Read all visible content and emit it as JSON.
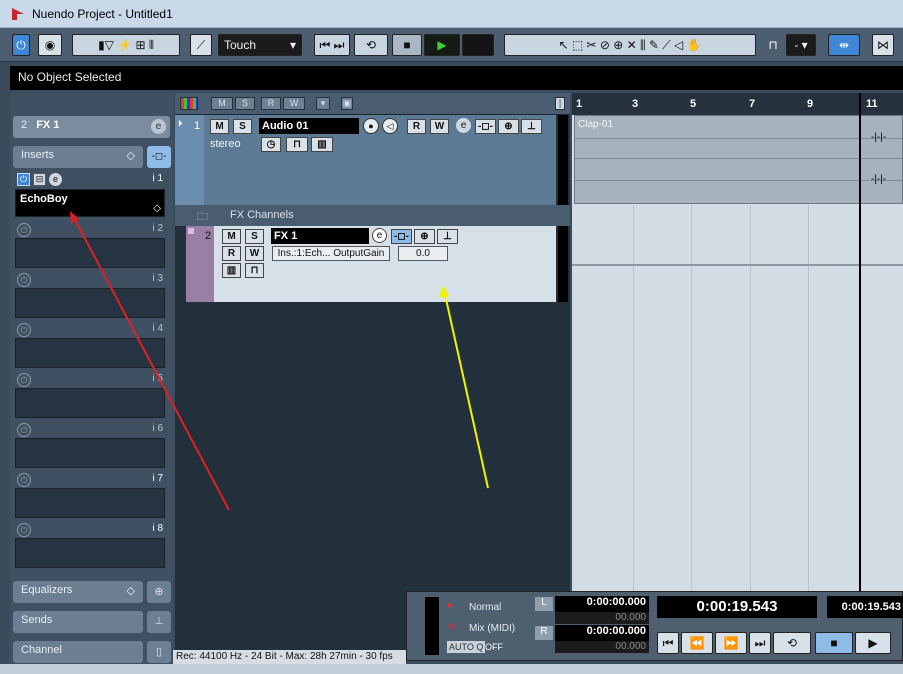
{
  "window": {
    "title": "Nuendo Project - Untitled1"
  },
  "toolbar": {
    "automation_mode": "Touch",
    "quantize_value": "-"
  },
  "status_line": "No Object Selected",
  "inspector": {
    "track_number": "2",
    "track_name": "FX 1",
    "inserts_label": "Inserts",
    "slot1_label": "i 1",
    "slot1_plugin": "EchoBoy",
    "slots": [
      "i 2",
      "i 3",
      "i 4",
      "i 5",
      "i 6",
      "i 7",
      "i 8"
    ],
    "equalizers_label": "Equalizers",
    "sends_label": "Sends",
    "channel_label": "Channel"
  },
  "tracks": {
    "track1": {
      "number": "1",
      "name": "Audio 01",
      "config": "stereo"
    },
    "folder": {
      "name": "FX Channels"
    },
    "track2": {
      "number": "2",
      "name": "FX 1",
      "automation_param": "Ins.:1:Ech... OutputGain",
      "automation_value": "0.0"
    }
  },
  "buttons": {
    "m": "M",
    "s": "S",
    "r": "R",
    "w": "W"
  },
  "ruler": {
    "ticks": [
      "1",
      "3",
      "5",
      "7",
      "9",
      "11"
    ]
  },
  "clip": {
    "name": "Clap-01"
  },
  "transport": {
    "record_mode": "Normal",
    "cycle_mode": "Mix (MIDI)",
    "auto_q": "AUTO Q",
    "auto_q_state": "OFF",
    "left_locator": "0:00:00.000",
    "left_offset": "00.000",
    "right_locator": "0:00:00.000",
    "right_offset": "00.000",
    "primary_time": "0:00:19.543",
    "secondary_time": "0:00:19.543"
  },
  "status_bar": "Rec: 44100 Hz - 24 Bit - Max: 28h 27min - 30 fps",
  "colors": {
    "accent_blue": "#3f86d6",
    "red_arrow": "#e02020",
    "yellow_arrow": "#f2f200"
  }
}
